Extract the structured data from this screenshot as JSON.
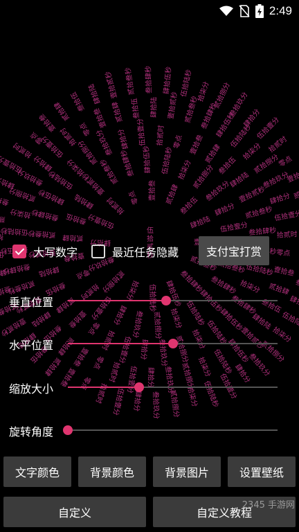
{
  "status_bar": {
    "time": "2:49"
  },
  "clock_text": {
    "color": "#b0307c",
    "ring_chars": [
      "壹拾贰秒",
      "贰拾叁秒",
      "叁拾肆秒",
      "肆拾伍秒",
      "伍拾陆秒",
      "拾柒分",
      "贰拾捌分",
      "叁拾玖分",
      "肆拾分",
      "伍拾壹分",
      "拾贰时",
      "零点",
      "壹拾叁",
      "贰拾肆",
      "叁拾伍",
      "肆拾陆"
    ],
    "center_chars": [
      "伍",
      "拾",
      "贰",
      "秒"
    ]
  },
  "controls": {
    "uppercase_digits": {
      "label": "大写数字",
      "checked": true
    },
    "hide_recents": {
      "label": "最近任务隐藏",
      "checked": false
    },
    "alipay_button": "支付宝打赏"
  },
  "sliders": [
    {
      "label": "垂直位置",
      "value": 0.47
    },
    {
      "label": "水平位置",
      "value": 0.5
    },
    {
      "label": "缩放大小",
      "value": 0.34
    },
    {
      "label": "旋转角度",
      "value": 0.0
    }
  ],
  "buttons": {
    "text_color": "文字颜色",
    "bg_color": "背景颜色",
    "bg_image": "背景图片",
    "set_wallpaper": "设置壁纸",
    "custom": "自定义",
    "custom_tutorial": "自定义教程"
  },
  "watermark": "2345 手游网",
  "accent_color": "#e0356f"
}
